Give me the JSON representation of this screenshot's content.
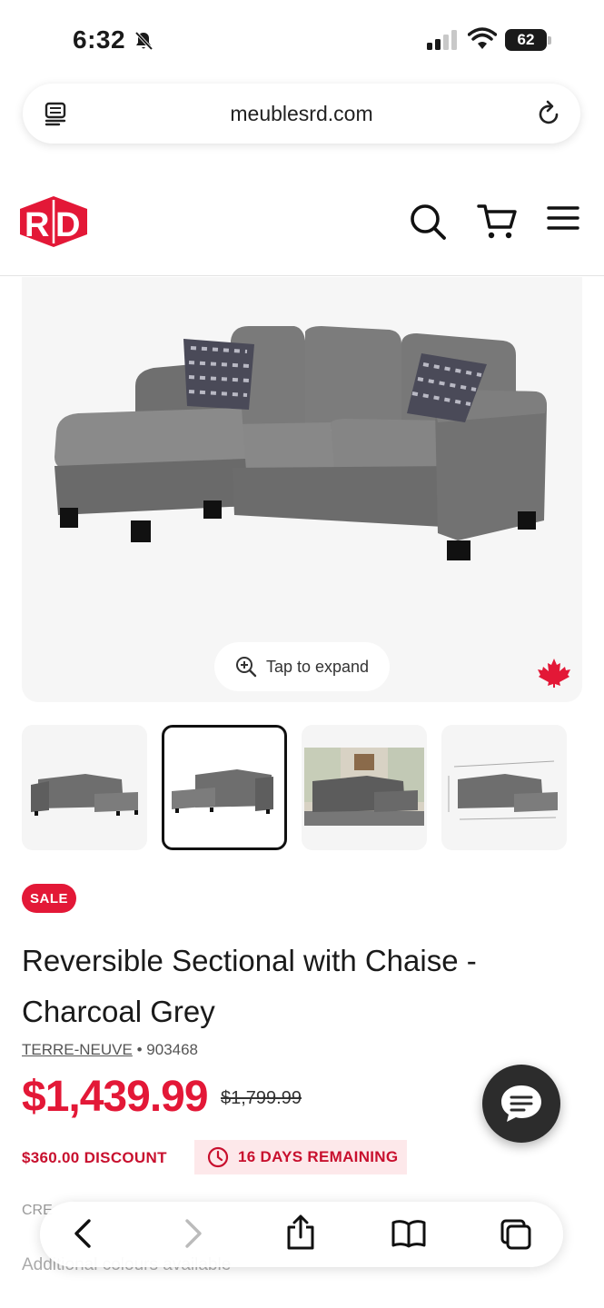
{
  "status": {
    "time": "6:32",
    "battery": "62"
  },
  "browser": {
    "url": "meublesrd.com"
  },
  "site": {
    "logo_text": "RD"
  },
  "hero": {
    "tap_to_expand": "Tap to expand"
  },
  "product": {
    "badge": "SALE",
    "title": "Reversible Sectional with Chaise - Charcoal Grey",
    "brand": "TERRE-NEUVE",
    "separator": "•",
    "sku": "903468",
    "price": "$1,439.99",
    "old_price": "$1,799.99",
    "discount": "$360.00 DISCOUNT",
    "days_remaining": "16 DAYS REMAINING",
    "credit_prefix": "CRE",
    "additional_colours": "Additional colours available"
  },
  "colors": {
    "brand_red": "#e31837",
    "discount_bg": "#fde8ea"
  },
  "icons": [
    "bell-slash-icon",
    "signal-icon",
    "wifi-icon",
    "reader-icon",
    "reload-icon",
    "search-icon",
    "cart-icon",
    "menu-icon",
    "zoom-in-icon",
    "maple-leaf-icon",
    "clock-icon",
    "chat-icon",
    "back-icon",
    "forward-icon",
    "share-icon",
    "bookmarks-icon",
    "tabs-icon"
  ]
}
